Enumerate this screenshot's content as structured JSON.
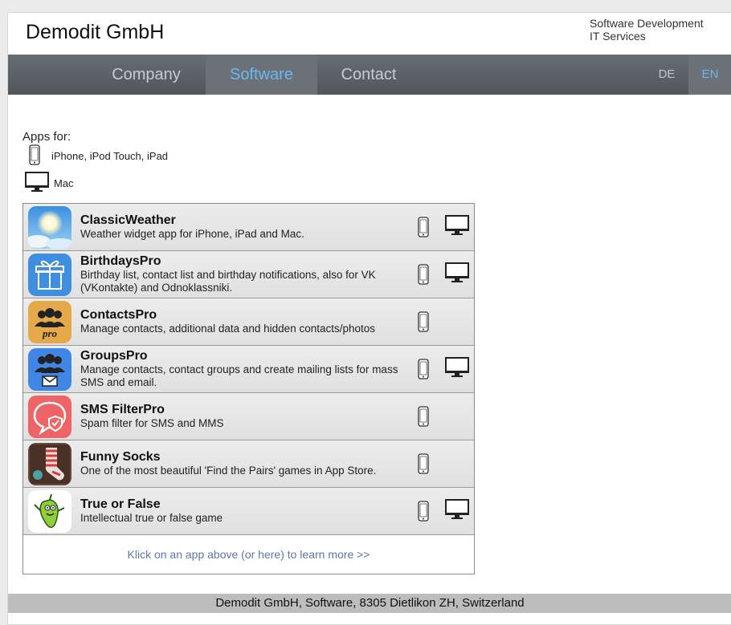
{
  "header": {
    "brand": "Demodit GmbH",
    "tagline_line1": "Software Development",
    "tagline_line2": "IT Services"
  },
  "nav": {
    "items": [
      {
        "label": "Company"
      },
      {
        "label": "Software"
      },
      {
        "label": "Contact"
      }
    ],
    "active": "Software",
    "languages": [
      {
        "label": "DE"
      },
      {
        "label": "EN"
      }
    ],
    "active_language": "EN",
    "accent_color": "#6cb8ee"
  },
  "legend": {
    "title": "Apps for:",
    "phone_label": "iPhone, iPod Touch, iPad",
    "mac_label": "Mac"
  },
  "apps": [
    {
      "name": "ClassicWeather",
      "description": "Weather widget app for iPhone, iPad and Mac.",
      "icon": "weather-sun-icon",
      "ios": true,
      "mac": true
    },
    {
      "name": "BirthdaysPro",
      "description": "Birthday list, contact list and birthday notifications, also for VK (VKontakte) and Odnoklassniki.",
      "icon": "gift-icon",
      "ios": true,
      "mac": true
    },
    {
      "name": "ContactsPro",
      "description": "Manage contacts, additional data and hidden contacts/photos",
      "icon": "contacts-pro-icon",
      "ios": true,
      "mac": false
    },
    {
      "name": "GroupsPro",
      "description": "Manage contacts, contact groups and create mailing lists for mass SMS and email.",
      "icon": "groups-mail-icon",
      "ios": true,
      "mac": true
    },
    {
      "name": "SMS FilterPro",
      "description": "Spam filter for SMS and MMS",
      "icon": "sms-shield-icon",
      "ios": true,
      "mac": false
    },
    {
      "name": "Funny Socks",
      "description": "One of the most beautiful 'Find the Pairs' games in App Store.",
      "icon": "sock-icon",
      "ios": true,
      "mac": false
    },
    {
      "name": "True or False",
      "description": "Intellectual true or false game",
      "icon": "pepper-character-icon",
      "ios": true,
      "mac": true
    }
  ],
  "more_link": "Klick on an app above (or here) to learn more >>",
  "footer": "Demodit GmbH, Software, 8305 Dietlikon ZH, Switzerland"
}
